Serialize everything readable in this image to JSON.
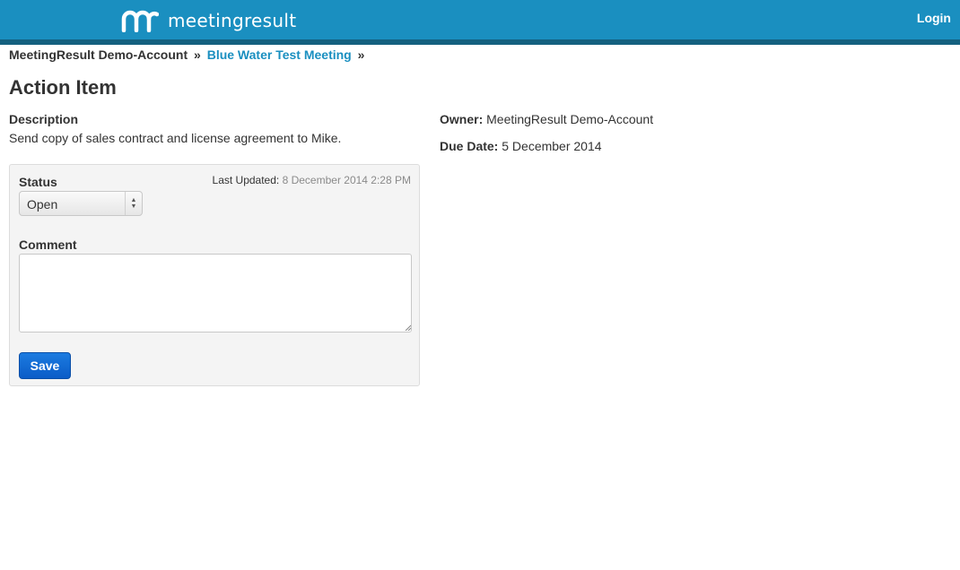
{
  "header": {
    "logo_text": "meetingresult",
    "login_label": "Login",
    "brand_color": "#1a8fc0",
    "logo_icon": "mr-logo-icon"
  },
  "breadcrumb": {
    "account": "MeetingResult Demo-Account",
    "separator": "»",
    "meeting": "Blue Water Test Meeting"
  },
  "page": {
    "title": "Action Item",
    "description_label": "Description",
    "description_text": "Send copy of sales contract and license agreement to Mike.",
    "owner_label": "Owner:",
    "owner_value": "MeetingResult Demo-Account",
    "due_label": "Due Date:",
    "due_value": "5 December 2014"
  },
  "form": {
    "status_label": "Status",
    "last_updated_label": "Last Updated:",
    "last_updated_value": "8 December 2014 2:28 PM",
    "status_selected": "Open",
    "comment_label": "Comment",
    "comment_value": "",
    "save_label": "Save"
  }
}
